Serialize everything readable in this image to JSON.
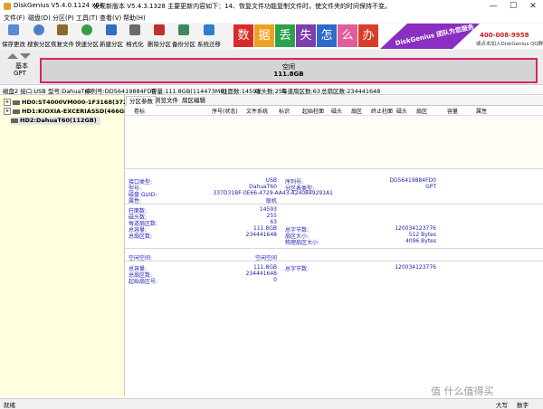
{
  "titlebar": {
    "title": "DiskGenius V5.4.0.1124 x64",
    "notice": "发现新版本 V5.4.3.1328 主要更新内容如下：14、恢复文件功能复制文件时，使文件夹的时间保持不变。",
    "minimize": "—",
    "maximize": "☐",
    "close": "✕"
  },
  "menubar": {
    "items": [
      "文件(F)",
      "磁盘(D)",
      "分区(P)",
      "工具(T)",
      "查看(V)",
      "帮助(H)"
    ]
  },
  "toolbar": {
    "buttons": [
      {
        "label": "保存更改",
        "icon": "save-icon",
        "color": "#5a8ad8"
      },
      {
        "label": "搜索分区",
        "icon": "search-partition-icon",
        "color": "#4c7fc5"
      },
      {
        "label": "恢复文件",
        "icon": "recover-files-icon",
        "color": "#8b6a2b"
      },
      {
        "label": "快速分区",
        "icon": "quick-partition-icon",
        "color": "#3a9a4a"
      },
      {
        "label": "新建分区",
        "icon": "new-partition-icon",
        "color": "#2f6fbf"
      },
      {
        "label": "格式化",
        "icon": "format-icon",
        "color": "#6a6a6a"
      },
      {
        "label": "删除分区",
        "icon": "delete-partition-icon",
        "color": "#c03030"
      },
      {
        "label": "备份分区",
        "icon": "backup-partition-icon",
        "color": "#3c8a5a"
      },
      {
        "label": "系统迁移",
        "icon": "system-migrate-icon",
        "color": "#2e7fd0"
      }
    ]
  },
  "banner": {
    "tiles": [
      {
        "ch": "数",
        "color": "#d92a2a"
      },
      {
        "ch": "据",
        "color": "#f0a020"
      },
      {
        "ch": "丢",
        "color": "#2ba24c"
      },
      {
        "ch": "失",
        "color": "#7d3fb0"
      },
      {
        "ch": "怎",
        "color": "#2d6bcc"
      },
      {
        "ch": "么",
        "color": "#e25c9a"
      },
      {
        "ch": "办",
        "color": "#d73e2a"
      }
    ],
    "brand": "DiskGenius 团队为您服务",
    "phone": "400-008-9958",
    "qq": "或点击加入DiskGenius QQ群"
  },
  "nav": {
    "label1": "基本",
    "label2": "GPT"
  },
  "diskbar": {
    "label": "空闲",
    "size": "111.8GB",
    "border_color": "#d6246e"
  },
  "diskinfo": {
    "items": [
      "磁盘2 接口:USB",
      "型号:DahuaT60",
      "序列号:DD56419884FD0",
      "容量:111.8GB(114473MB)",
      "柱面数:14593",
      "磁头数:255",
      "每道扇区数:63",
      "总扇区数:234441648"
    ]
  },
  "tree": {
    "nodes": [
      {
        "label": "HD0:ST4000VM000-1F3168(3726GB)"
      },
      {
        "label": "HD1:KIOXIA-EXCERIASSD(466GB)"
      },
      {
        "label": "HD2:DahuaT60(112GB)"
      }
    ]
  },
  "tabs": [
    "分区参数",
    "浏览文件",
    "扇区编辑"
  ],
  "columns": [
    "卷标",
    "序号(状态)",
    "文件系统",
    "标识",
    "起始柱面",
    "磁头",
    "扇区",
    "终止柱面",
    "磁头",
    "扇区",
    "容量",
    "属性"
  ],
  "details": {
    "interface_label": "接口类型:",
    "interface": "USB",
    "serial_label": "序列号:",
    "serial": "DD56419884FD0",
    "model_label": "型号:",
    "model": "DahuaT60",
    "ptype_label": "分区表类型:",
    "ptype": "GPT",
    "guid_label": "磁盘 GUID:",
    "guid": "337D31BF-0E66-4729-AA43-A240849291A1",
    "attr_label": "属性:",
    "attr": "联机",
    "cyl_label": "柱面数:",
    "cyl": "14593",
    "heads_label": "磁头数:",
    "heads": "255",
    "spt_label": "每道扇区数:",
    "spt": "63",
    "cap_label": "总容量:",
    "cap": "111.8GB",
    "bytes_label": "总字节数:",
    "bytes": "120034123776",
    "sectors_label": "总扇区数:",
    "sectors": "234441648",
    "secsize_label": "扇区大小:",
    "secsize": "512 Bytes",
    "phys_label": "物理扇区大小:",
    "phys": "4096 Bytes",
    "free_label": "空闲空间:",
    "free": "空闲空间",
    "fcap_label": "总容量:",
    "fcap": "111.8GB",
    "fbytes_label": "总字节数:",
    "fbytes": "120034123776",
    "fsec_label": "总扇区数:",
    "fsec": "234441648",
    "fstart_label": "起始扇区号:",
    "fstart": "0"
  },
  "statusbar": {
    "status": "就绪",
    "caps": "大写",
    "num": "数字"
  },
  "watermark": "值 什么值得买"
}
